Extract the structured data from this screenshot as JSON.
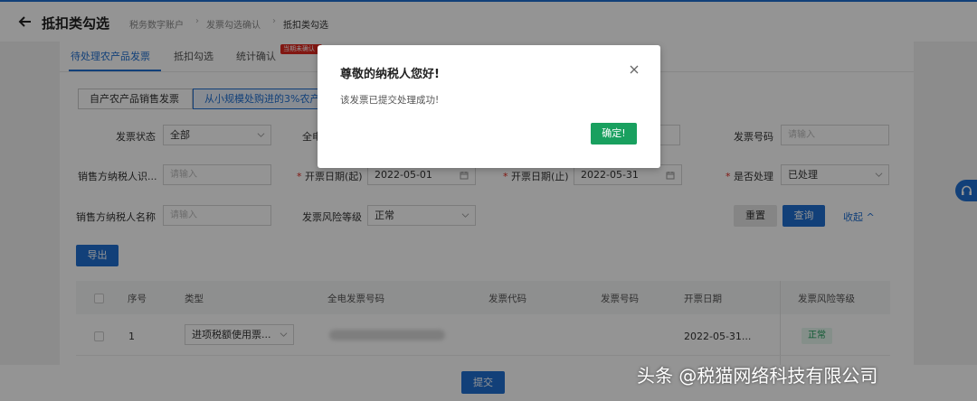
{
  "header": {
    "title": "抵扣类勾选",
    "breadcrumb": [
      "税务数字账户",
      "发票勾选确认",
      "抵扣类勾选"
    ]
  },
  "tabs": {
    "items": [
      "待处理农产品发票",
      "抵扣勾选",
      "统计确认"
    ],
    "red_tag": "当期未确认"
  },
  "segments": [
    "自产农产品销售发票",
    "从小规模处购进的3%农产品"
  ],
  "filters": {
    "status_label": "发票状态",
    "status_value": "全部",
    "full_label": "全电",
    "invoice_no_label": "发票号码",
    "invoice_no_placeholder": "请输入",
    "seller_id_label": "销售方纳税人识...",
    "seller_id_placeholder": "请输入",
    "date_start_label": "开票日期(起)",
    "date_start_value": "2022-05-01",
    "date_end_label": "开票日期(止)",
    "date_end_value": "2022-05-31",
    "processed_label": "是否处理",
    "processed_value": "已处理",
    "seller_name_label": "销售方纳税人名称",
    "seller_name_placeholder": "请输入",
    "risk_label": "发票风险等级",
    "risk_value": "正常",
    "required_mark": "*"
  },
  "actions": {
    "reset": "重置",
    "query": "查询",
    "collapse": "收起",
    "export": "导出",
    "submit": "提交"
  },
  "table": {
    "headers": [
      "序号",
      "类型",
      "全电发票号码",
      "发票代码",
      "发票号码",
      "开票日期",
      "发票风险等级"
    ],
    "rows": [
      {
        "index": "1",
        "type": "进项税额使用票...",
        "date": "2022-05-31...",
        "risk": "正常"
      }
    ]
  },
  "modal": {
    "title": "尊敬的纳税人您好!",
    "message": "该发票已提交处理成功!",
    "ok": "确定!"
  },
  "watermark": "头条 @税猫网络科技有限公司",
  "colors": {
    "primary": "#1f6fd1",
    "success": "#19a05f",
    "danger": "#e0281f"
  }
}
